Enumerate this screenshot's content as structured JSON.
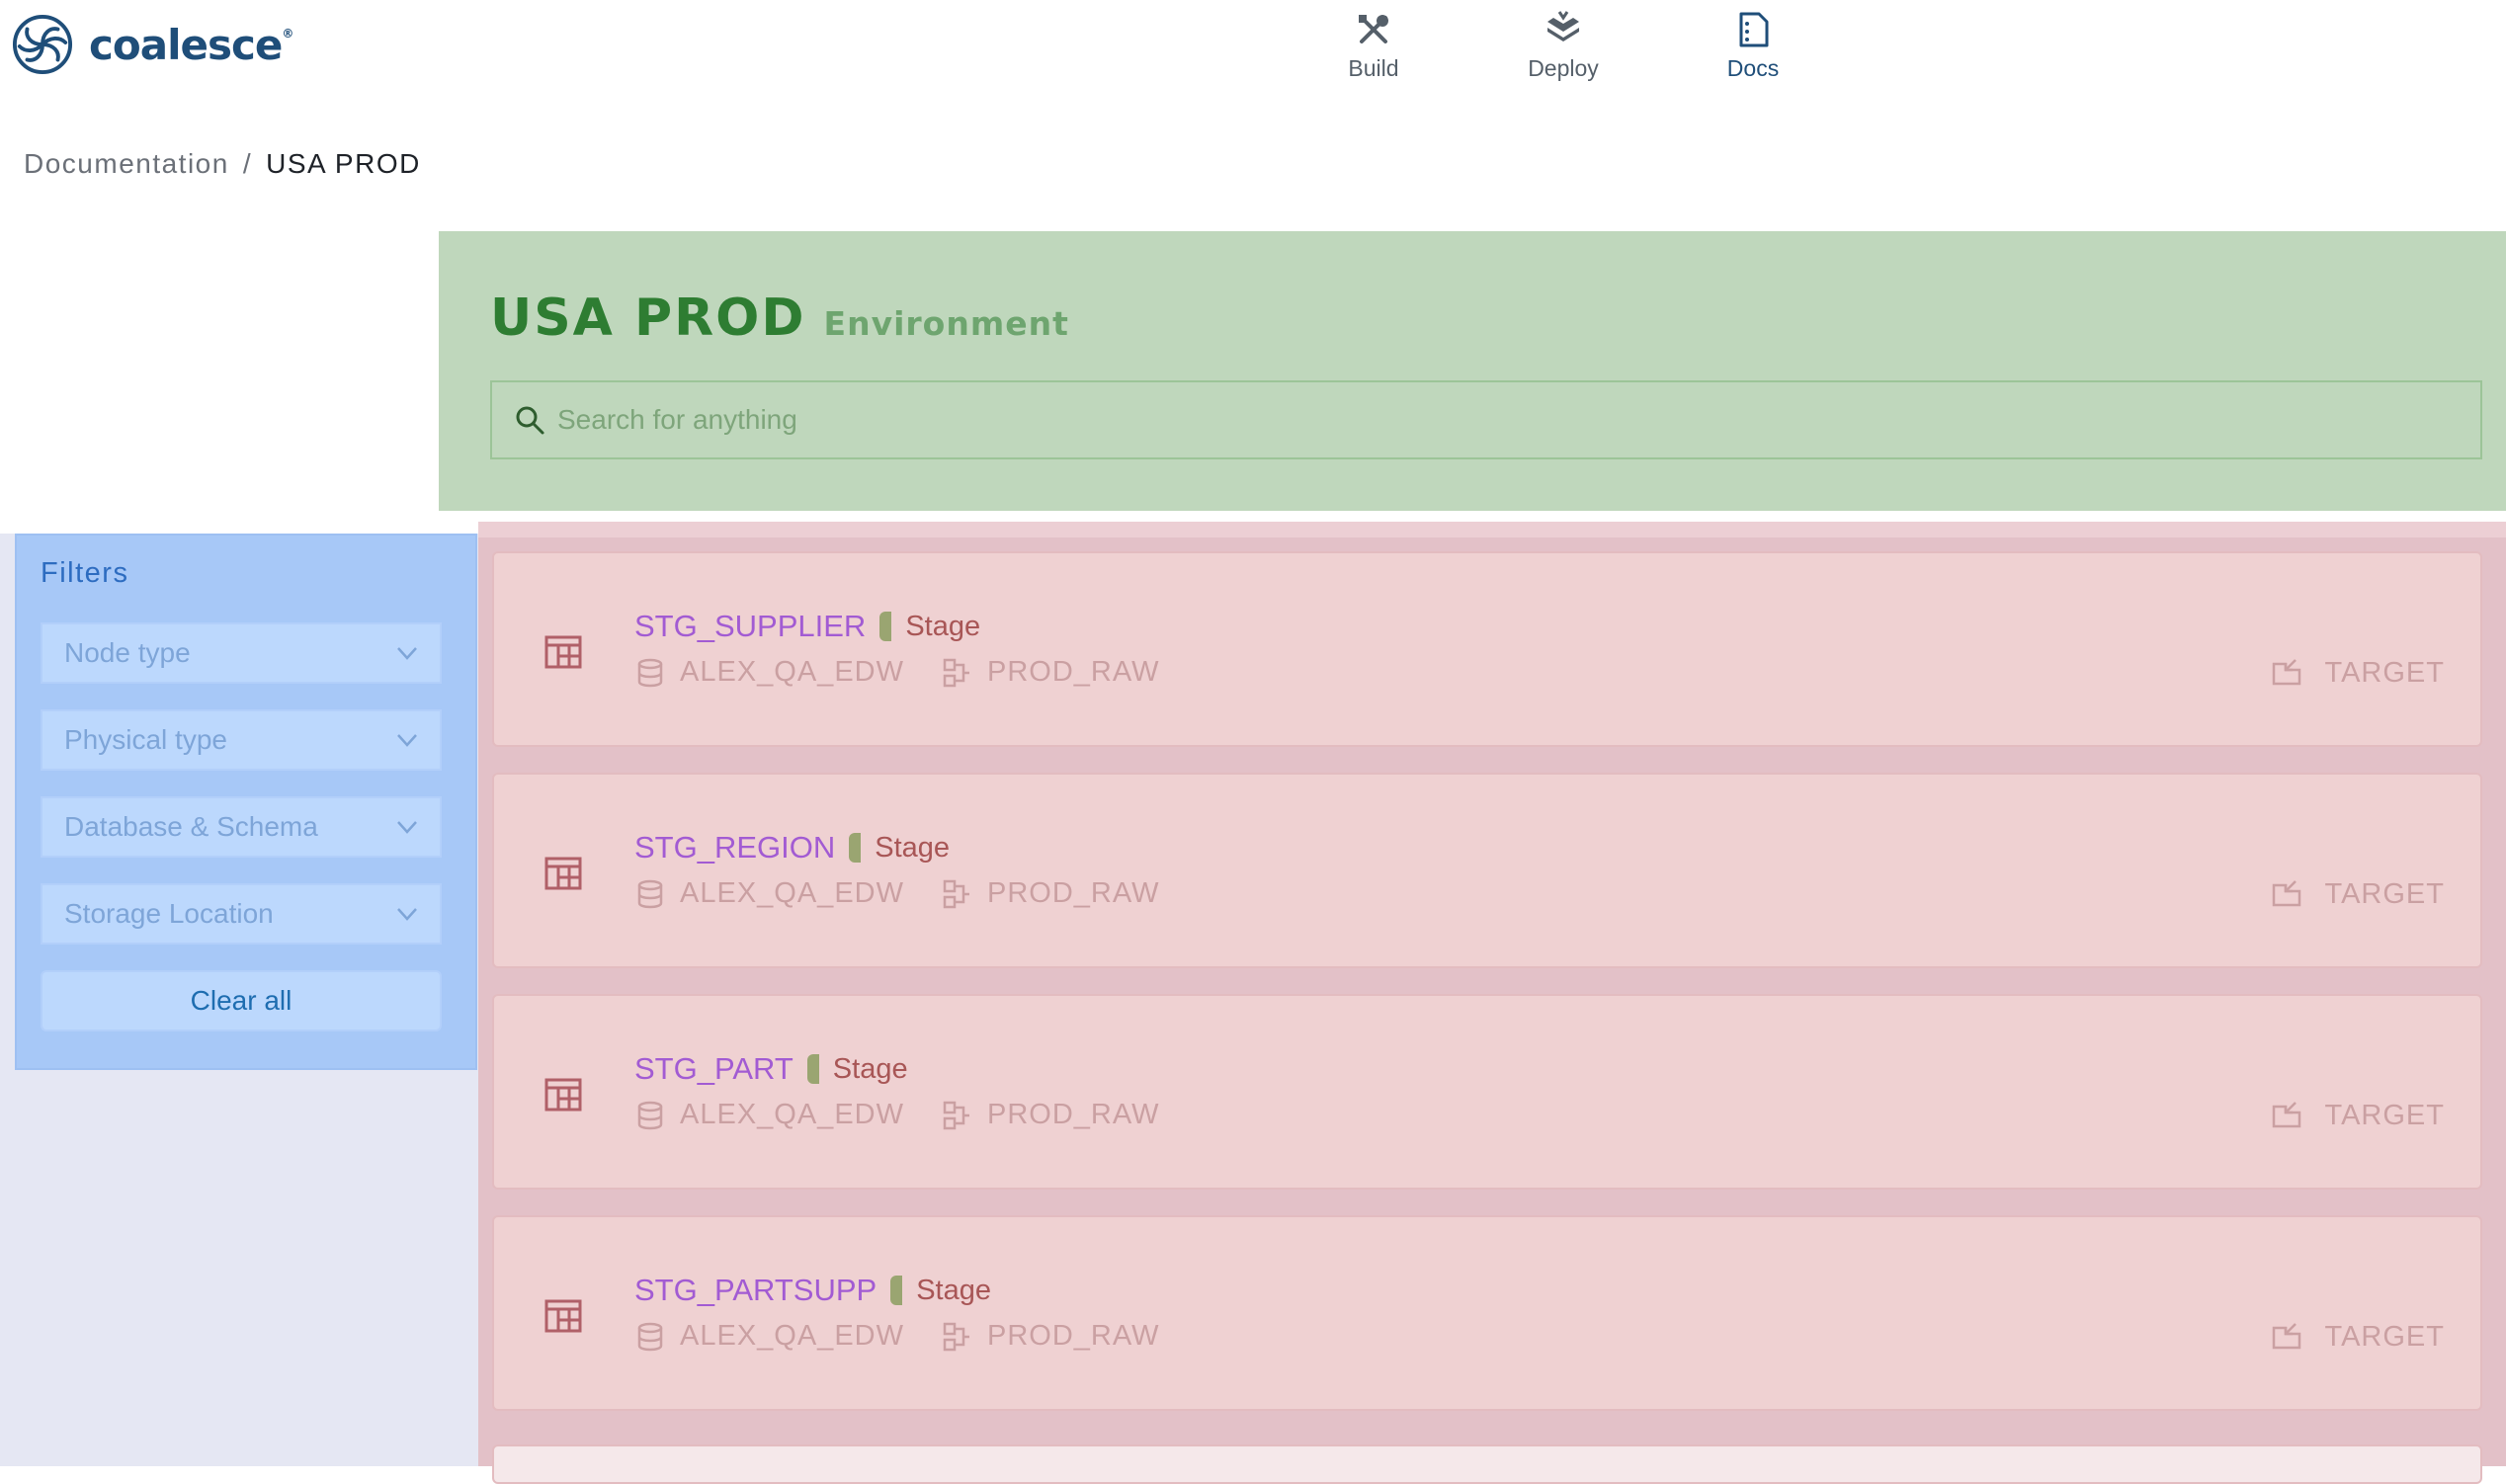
{
  "app": {
    "name": "coalesce",
    "trademark": "®"
  },
  "nav": [
    {
      "label": "Build",
      "icon": "tools-icon",
      "active": false
    },
    {
      "label": "Deploy",
      "icon": "deploy-icon",
      "active": false
    },
    {
      "label": "Docs",
      "icon": "docs-icon",
      "active": true
    }
  ],
  "breadcrumb": {
    "root": "Documentation",
    "separator": "/",
    "current": "USA PROD"
  },
  "environment": {
    "name": "USA PROD",
    "type": "Environment"
  },
  "search": {
    "placeholder": "Search for anything"
  },
  "filters": {
    "title": "Filters",
    "selects": [
      {
        "label": "Node type"
      },
      {
        "label": "Physical type"
      },
      {
        "label": "Database & Schema"
      },
      {
        "label": "Storage Location"
      }
    ],
    "clear_label": "Clear all"
  },
  "nodes": [
    {
      "name": "STG_SUPPLIER",
      "type": "Stage",
      "database": "ALEX_QA_EDW",
      "schema": "PROD_RAW",
      "location": "TARGET"
    },
    {
      "name": "STG_REGION",
      "type": "Stage",
      "database": "ALEX_QA_EDW",
      "schema": "PROD_RAW",
      "location": "TARGET"
    },
    {
      "name": "STG_PART",
      "type": "Stage",
      "database": "ALEX_QA_EDW",
      "schema": "PROD_RAW",
      "location": "TARGET"
    },
    {
      "name": "STG_PARTSUPP",
      "type": "Stage",
      "database": "ALEX_QA_EDW",
      "schema": "PROD_RAW",
      "location": "TARGET"
    }
  ],
  "colors": {
    "brand": "#1f4e79",
    "hero_bg": "#bfd7bc",
    "env_name": "#2e7d32",
    "filters_bg": "#a7c8f7",
    "results_bg": "#e3c1c8",
    "node_name": "#a25bd3",
    "stage_pill": "#9aa571"
  }
}
